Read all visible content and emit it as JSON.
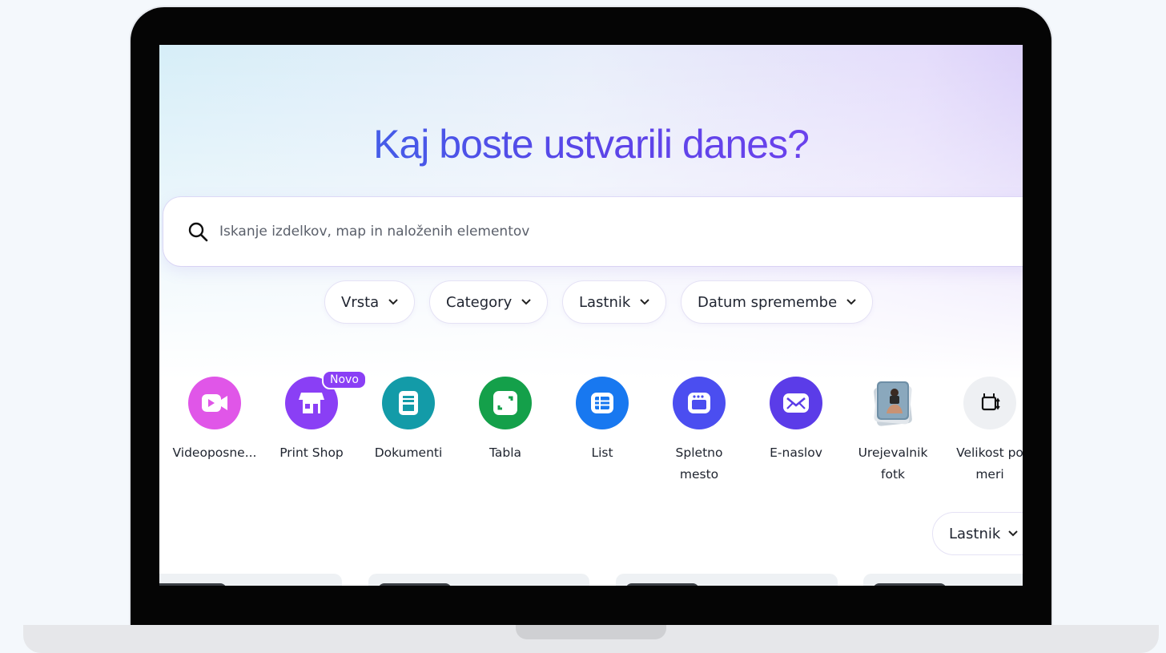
{
  "hero": {
    "title": "Kaj boste ustvarili danes?"
  },
  "search": {
    "placeholder": "Iskanje izdelkov, map in naloženih elementov",
    "icon": "search-icon"
  },
  "filters": [
    {
      "label": "Vrsta"
    },
    {
      "label": "Category"
    },
    {
      "label": "Lastnik"
    },
    {
      "label": "Datum spremembe"
    }
  ],
  "tools": [
    {
      "label": "Videoposne...",
      "color": "#e056e8",
      "icon": "video-camera-icon"
    },
    {
      "label": "Print Shop",
      "color": "#8a3ff5",
      "icon": "storefront-icon",
      "badge": "Novo"
    },
    {
      "label": "Dokumenti",
      "color": "#139ba8",
      "icon": "document-icon"
    },
    {
      "label": "Tabla",
      "color": "#14a04a",
      "icon": "whiteboard-icon"
    },
    {
      "label": "List",
      "color": "#1878f0",
      "icon": "sheet-table-icon"
    },
    {
      "label": "Spletno\nmesto",
      "color": "#4b4ef0",
      "icon": "website-icon"
    },
    {
      "label": "E-naslov",
      "color": "#5b3ce8",
      "icon": "envelope-icon"
    },
    {
      "label": "Urejevalnik\nfotk",
      "color": "#a9c3d6",
      "icon": "photo-editor-icon"
    },
    {
      "label": "Velikost po\nmeri",
      "color": "#eef0f3",
      "icon": "custom-size-icon"
    }
  ],
  "content_filter": {
    "label": "Lastnik"
  }
}
